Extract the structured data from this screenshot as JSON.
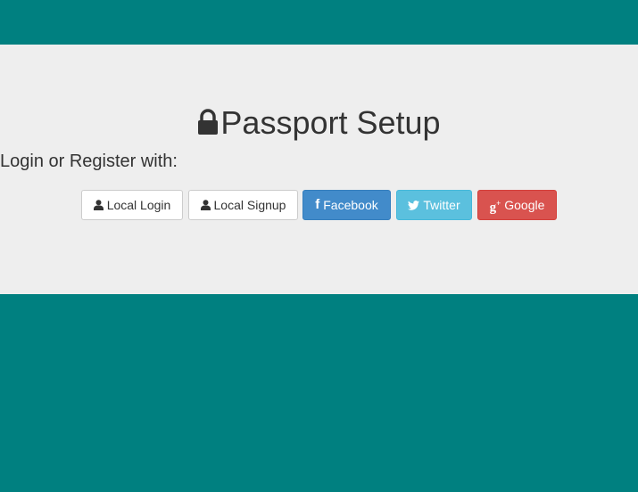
{
  "header": {
    "title": "Passport Setup",
    "title_icon": "lock-icon",
    "subtitle": "Login or Register with:"
  },
  "buttons": {
    "local_login": {
      "label": "Local Login",
      "icon": "user-icon"
    },
    "local_signup": {
      "label": "Local Signup",
      "icon": "user-icon"
    },
    "facebook": {
      "label": "Facebook",
      "icon": "facebook-icon"
    },
    "twitter": {
      "label": "Twitter",
      "icon": "twitter-icon"
    },
    "google": {
      "label": "Google",
      "icon": "google-plus-icon"
    }
  },
  "colors": {
    "background": "#008080",
    "panel": "#eeeeee",
    "facebook": "#428bca",
    "twitter": "#5bc0de",
    "google": "#d9534f"
  }
}
